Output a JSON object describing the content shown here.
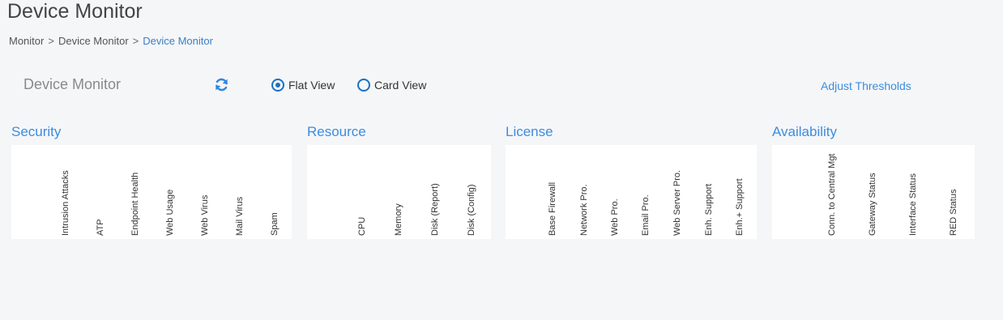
{
  "page": {
    "title": "Device Monitor"
  },
  "breadcrumb": {
    "items": [
      "Monitor",
      "Device Monitor",
      "Device Monitor"
    ],
    "separator": ">"
  },
  "toolbar": {
    "panel_title": "Device Monitor",
    "refresh_icon": "refresh-icon",
    "view_options": [
      {
        "label": "Flat View",
        "selected": true
      },
      {
        "label": "Card View",
        "selected": false
      }
    ],
    "adjust_label": "Adjust Thresholds"
  },
  "groups": [
    {
      "title": "Security",
      "columns": [
        "Intrusion Attacks",
        "ATP",
        "Endpoint Health",
        "Web Usage",
        "Web Virus",
        "Mail Virus",
        "Spam"
      ]
    },
    {
      "title": "Resource",
      "columns": [
        "CPU",
        "Memory",
        "Disk (Report)",
        "Disk (Config)"
      ]
    },
    {
      "title": "License",
      "columns": [
        "Base Firewall",
        "Network Pro.",
        "Web Pro.",
        "Email Pro.",
        "Web Server Pro.",
        "Enh. Support",
        "Enh.+ Support"
      ]
    },
    {
      "title": "Availability",
      "columns": [
        "Conn. to Central Mgt",
        "Gateway Status",
        "Interface Status",
        "RED Status"
      ]
    }
  ],
  "colors": {
    "accent": "#3b8de0",
    "radio": "#1a6fc4",
    "background": "#f5f6f8"
  }
}
